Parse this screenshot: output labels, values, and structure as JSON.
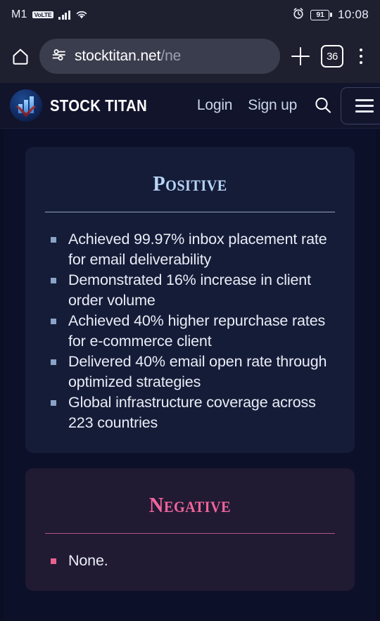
{
  "status_bar": {
    "carrier": "M1",
    "network_badge": "VoLTE",
    "signal_icon": "signal-bars-icon",
    "wifi_icon": "wifi-icon",
    "alarm_icon": "alarm-clock-icon",
    "battery_percent": "91",
    "time": "10:08"
  },
  "browser": {
    "home_icon": "home-icon",
    "url_icon": "page-settings-icon",
    "url_main": "stocktitan.net",
    "url_path": "/ne",
    "new_tab_icon": "plus-icon",
    "tab_count": "36",
    "menu_icon": "three-dot-menu-icon"
  },
  "site_header": {
    "logo_icon": "stock-titan-logo-icon",
    "brand": "STOCK TITAN",
    "login_label": "Login",
    "signup_label": "Sign up",
    "search_icon": "search-icon",
    "hamburger_icon": "hamburger-menu-icon"
  },
  "content": {
    "positive_card": {
      "title": "Positive",
      "bullets": [
        "Achieved 99.97% inbox placement rate for email deliverability",
        "Demonstrated 16% increase in client order volume",
        "Achieved 40% higher repurchase rates for e-commerce client",
        "Delivered 40% email open rate through optimized strategies",
        "Global infrastructure coverage across 223 countries"
      ]
    },
    "negative_card": {
      "title": "Negative",
      "bullets": [
        "None."
      ]
    }
  },
  "colors": {
    "page_bg": "#0c0f23",
    "positive_card_bg": "#151c38",
    "negative_card_bg": "#211a33",
    "positive_accent": "#b6d4f7",
    "negative_accent": "#f2649c",
    "header_bg": "#11142b",
    "chrome_bg": "#1e2030"
  }
}
